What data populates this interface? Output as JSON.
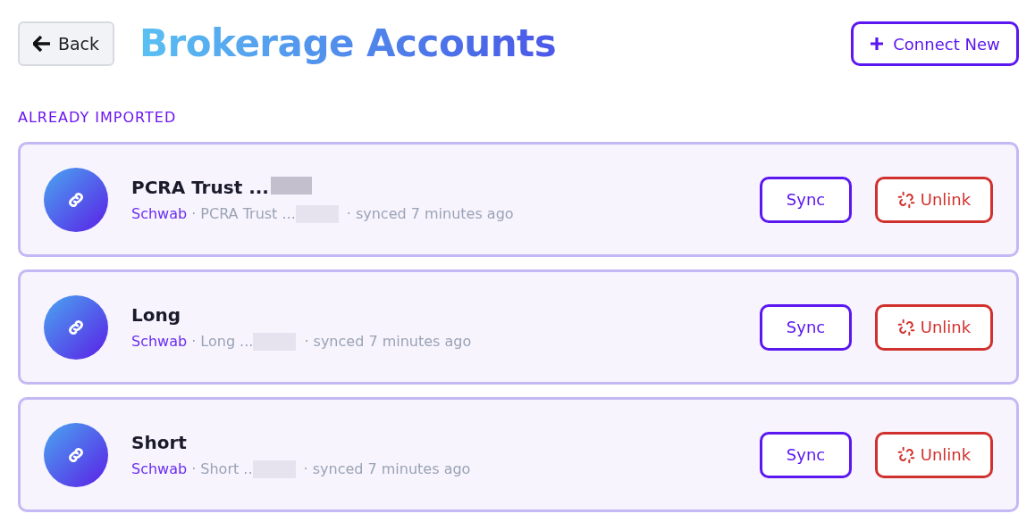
{
  "header": {
    "back_label": "Back",
    "title": "Brokerage Accounts",
    "connect_label": "Connect New"
  },
  "section_label": "ALREADY IMPORTED",
  "accounts": [
    {
      "name": "PCRA Trust ...",
      "name_redacted": true,
      "provider": "Schwab",
      "account": "· PCRA Trust ...",
      "account_redacted": true,
      "synced": "· synced 7 minutes ago",
      "sync_label": "Sync",
      "unlink_label": "Unlink"
    },
    {
      "name": "Long",
      "name_redacted": false,
      "provider": "Schwab",
      "account": "· Long ...",
      "account_redacted": true,
      "synced": "· synced 7 minutes ago",
      "sync_label": "Sync",
      "unlink_label": "Unlink"
    },
    {
      "name": "Short",
      "name_redacted": false,
      "provider": "Schwab",
      "account": "· Short ..",
      "account_redacted": true,
      "synced": "· synced 7 minutes ago",
      "sync_label": "Sync",
      "unlink_label": "Unlink"
    }
  ]
}
